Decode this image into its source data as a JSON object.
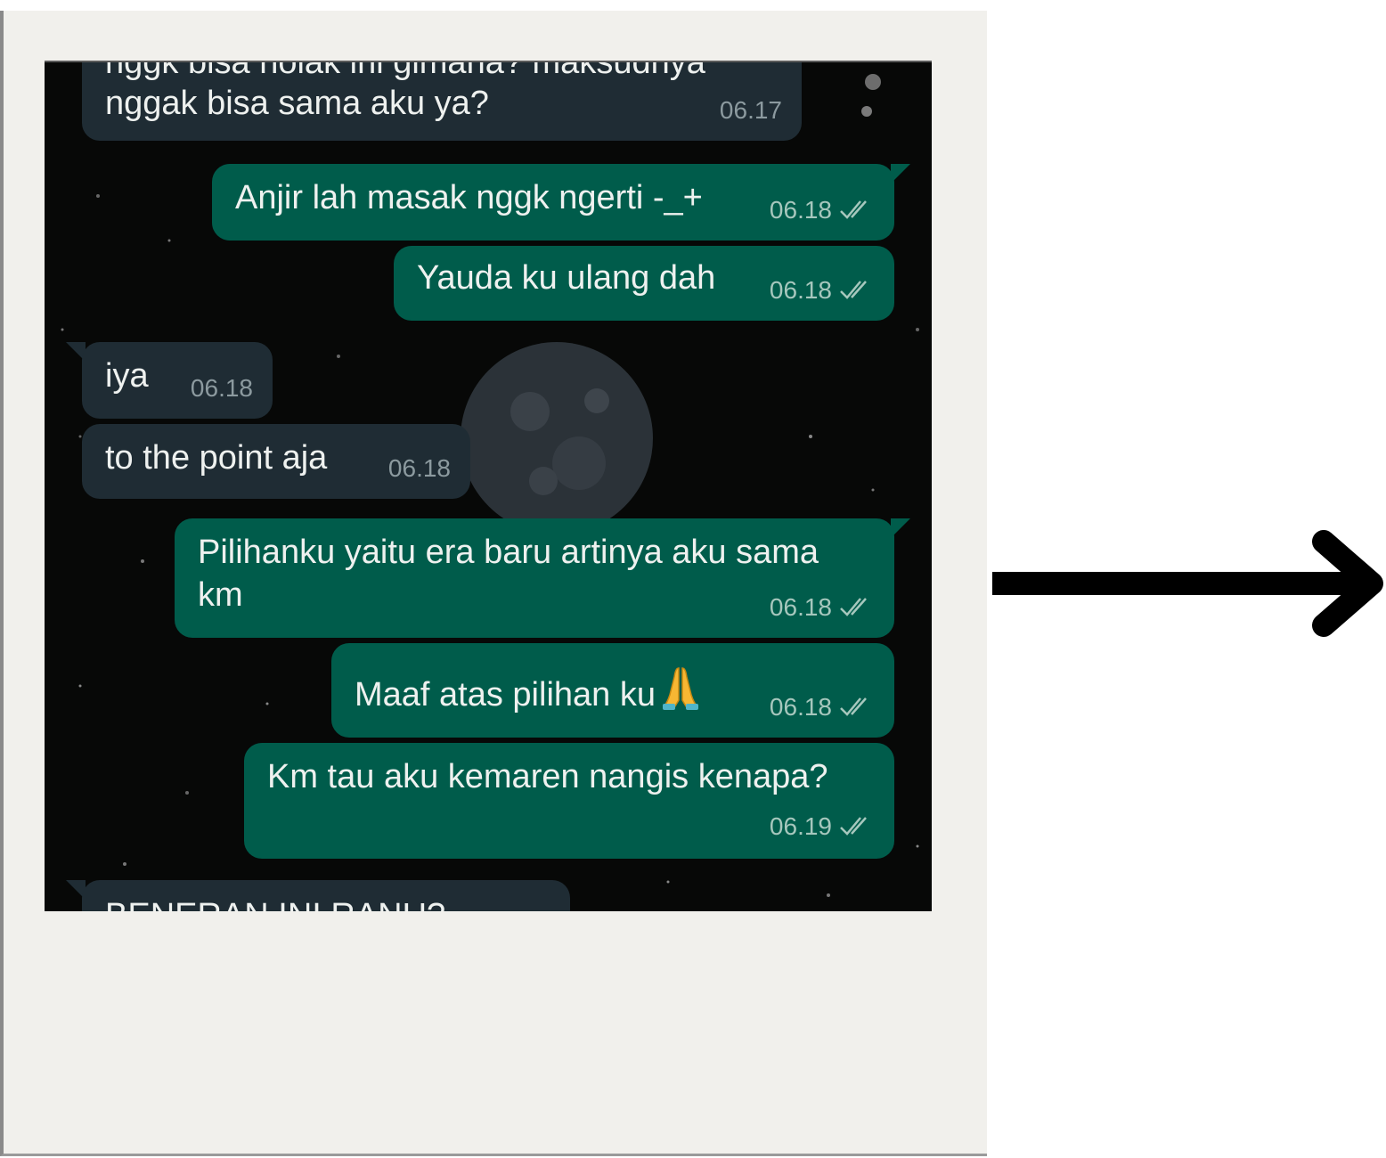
{
  "messages": [
    {
      "direction": "in",
      "lines": [
        "nggk bisa nolak ini gimana? maksudnya",
        "nggak bisa sama aku ya?"
      ],
      "time": "06.17"
    },
    {
      "direction": "out",
      "lines": [
        "Anjir lah masak nggk ngerti -_+"
      ],
      "time": "06.18",
      "status": "read"
    },
    {
      "direction": "out",
      "lines": [
        "Yauda ku ulang dah"
      ],
      "time": "06.18",
      "status": "read"
    },
    {
      "direction": "in",
      "lines": [
        "iya"
      ],
      "time": "06.18"
    },
    {
      "direction": "in",
      "lines": [
        "to the point aja"
      ],
      "time": "06.18"
    },
    {
      "direction": "out",
      "lines": [
        "Pilihanku yaitu era baru artinya aku sama",
        "km"
      ],
      "time": "06.18",
      "status": "read"
    },
    {
      "direction": "out",
      "lines": [
        "Maaf atas pilihan ku"
      ],
      "emoji": "folded-hands",
      "time": "06.18",
      "status": "read"
    },
    {
      "direction": "out",
      "lines": [
        "Km tau aku kemaren nangis kenapa?"
      ],
      "time": "06.19",
      "status": "read"
    },
    {
      "direction": "in",
      "lines": [
        "BENERAN INI RANU?"
      ],
      "time": ""
    }
  ],
  "colors": {
    "incoming_bubble": "#1f2c34",
    "outgoing_bubble": "#005c4b",
    "chat_background": "#070807",
    "card_background": "#f1f0ec",
    "arrow": "#000000"
  },
  "icons": {
    "read_status": "double-check-icon",
    "next": "arrow-right-icon"
  }
}
